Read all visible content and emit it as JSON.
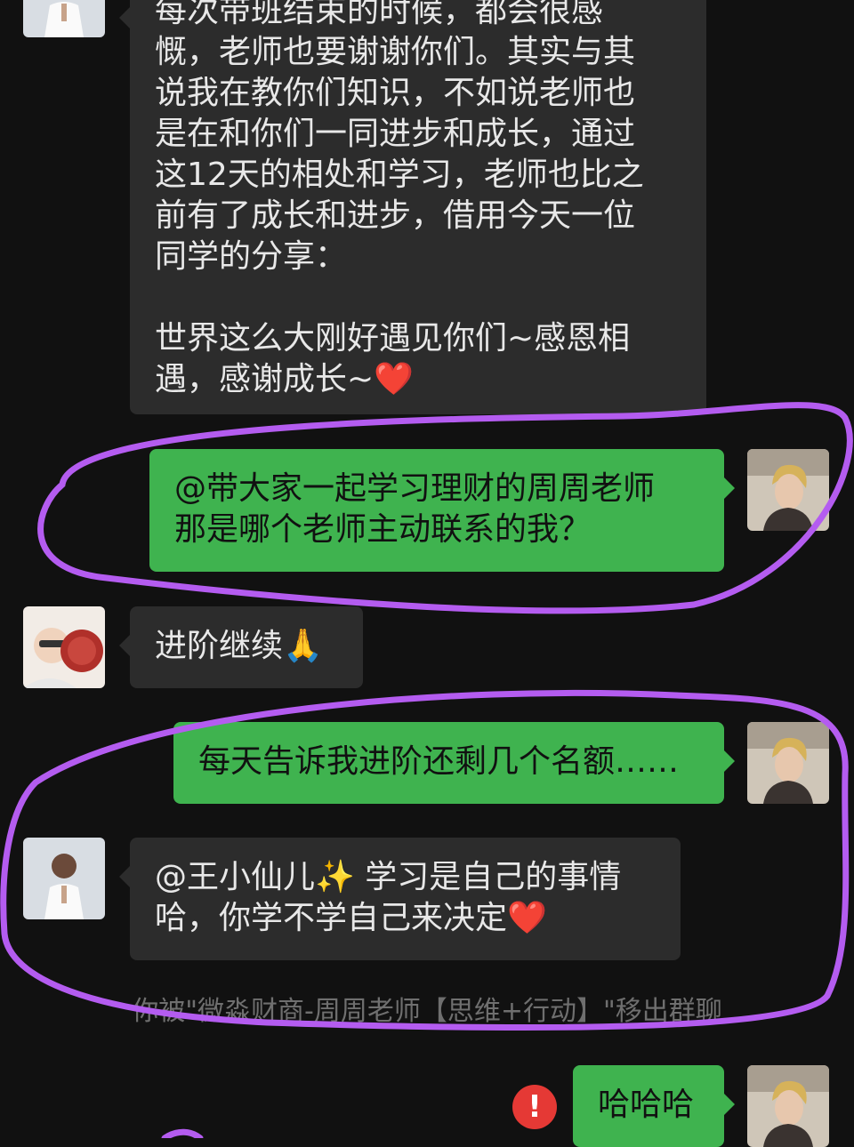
{
  "messages": {
    "m1": {
      "lines": [
        "每次带班结束的时候，都会很感",
        "慨，老师也要谢谢你们。其实与其",
        "说我在教你们知识，不如说老师也",
        "是在和你们一同进步和成长，通过",
        "这12天的相处和学习，老师也比之",
        "前有了成长和进步，借用今天一位",
        "同学的分享：",
        "",
        "世界这么大刚好遇见你们~感恩相",
        "遇，感谢成长~"
      ],
      "emoji": "❤️"
    },
    "m2": {
      "lines": [
        "@带大家一起学习理财的周周老师",
        "那是哪个老师主动联系的我？"
      ]
    },
    "m3": {
      "text": "进阶继续",
      "emoji": "🙏"
    },
    "m4": {
      "text": "每天告诉我进阶还剩几个名额……"
    },
    "m5": {
      "lines": [
        "@王小仙儿✨ 学习是自己的事情",
        "哈，你学不学自己来决定"
      ],
      "emoji": "❤️"
    },
    "system": "你被\"微淼财商-周周老师【思维+行动】\"移出群聊",
    "m6": {
      "text": "哈哈哈",
      "failed_icon": "!"
    }
  },
  "colors": {
    "outgoing_bubble": "#3fb34f",
    "incoming_bubble": "#2c2c2c",
    "annotation": "#b45cf0",
    "alert": "#e53935"
  },
  "icons": {
    "teacher_avatar": "avatar-teacher",
    "self_avatar": "avatar-self",
    "friend_avatar": "avatar-friend",
    "send_failed": "exclamation-icon"
  }
}
